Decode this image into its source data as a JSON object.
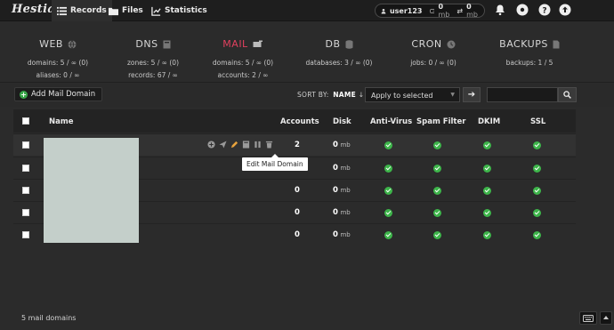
{
  "app": {
    "logo": "Hestia"
  },
  "topnav": [
    {
      "label": "Records",
      "icon": "list-icon",
      "active": true
    },
    {
      "label": "Files",
      "icon": "folder-icon",
      "active": false
    },
    {
      "label": "Statistics",
      "icon": "chart-icon",
      "active": false
    }
  ],
  "user": {
    "name": "user123",
    "disk": "0",
    "disk_unit": "mb",
    "bandwidth": "0",
    "bandwidth_unit": "mb"
  },
  "stats": {
    "web": {
      "title": "WEB",
      "line1": "domains: 5 / ∞ (0)",
      "line2": "aliases: 0 / ∞"
    },
    "dns": {
      "title": "DNS",
      "line1": "zones: 5 / ∞ (0)",
      "line2": "records: 67 / ∞"
    },
    "mail": {
      "title": "MAIL",
      "line1": "domains: 5 / ∞ (0)",
      "line2": "accounts: 2 / ∞"
    },
    "db": {
      "title": "DB",
      "line1": "databases: 3 / ∞ (0)"
    },
    "cron": {
      "title": "CRON",
      "line1": "jobs: 0 / ∞ (0)"
    },
    "backups": {
      "title": "BACKUPS",
      "line1": "backups: 1 / 5"
    }
  },
  "toolbar": {
    "add_label": "Add Mail Domain",
    "sort_label": "SORT BY:",
    "sort_value": "NAME",
    "apply_label": "Apply to selected",
    "search_placeholder": ""
  },
  "table": {
    "headers": {
      "name": "Name",
      "accounts": "Accounts",
      "disk": "Disk",
      "antivirus": "Anti-Virus",
      "spam": "Spam Filter",
      "dkim": "DKIM",
      "ssl": "SSL"
    },
    "rows": [
      {
        "accounts": "2",
        "disk": "0",
        "disk_unit": "mb"
      },
      {
        "accounts": "0",
        "disk": "0",
        "disk_unit": "mb"
      },
      {
        "accounts": "0",
        "disk": "0",
        "disk_unit": "mb"
      },
      {
        "accounts": "0",
        "disk": "0",
        "disk_unit": "mb"
      },
      {
        "accounts": "0",
        "disk": "0",
        "disk_unit": "mb"
      }
    ],
    "tooltip": "Edit Mail Domain"
  },
  "footer": {
    "count": "5 mail domains"
  },
  "colors": {
    "accent_mail": "#e0405e",
    "check": "#3db54a",
    "add": "#3aa64a"
  }
}
